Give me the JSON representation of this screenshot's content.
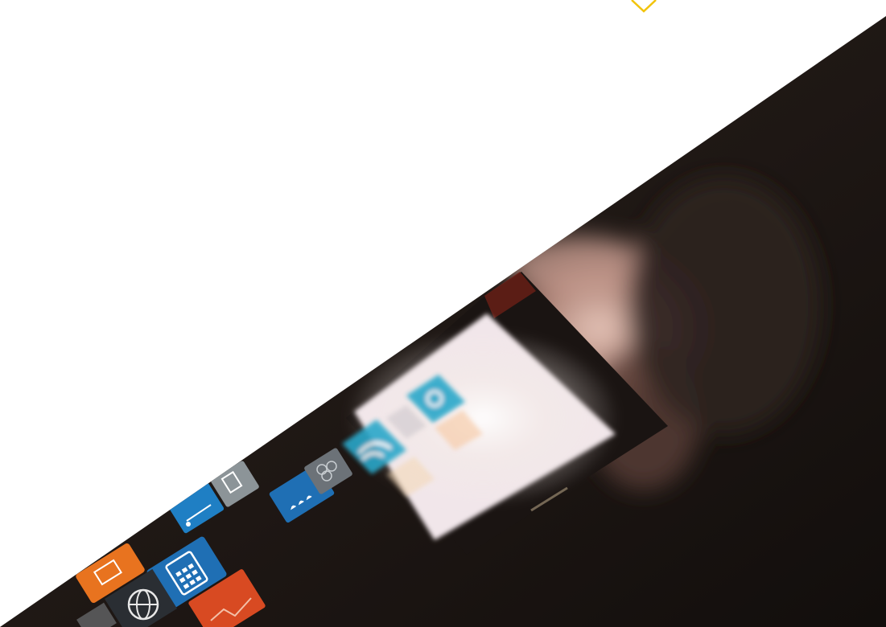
{
  "image": {
    "kind": "photo",
    "background_color": "#ffffff",
    "photo_base_color": "#1e1714",
    "accent_color": "#f2c40c"
  },
  "app_icons": [
    {
      "name": "presentation-icon",
      "color": "#e8731f"
    },
    {
      "name": "thermometer-icon",
      "color": "#1f7fc4"
    },
    {
      "name": "document-icon",
      "color": "#8c9498"
    },
    {
      "name": "calculator-icon",
      "color": "#1f6fb4"
    },
    {
      "name": "globe-icon",
      "color": "#2a2e33"
    },
    {
      "name": "chart-icon",
      "color": "#d84a22"
    },
    {
      "name": "weather-icon",
      "color": "#1f6fb4"
    },
    {
      "name": "grid-icon",
      "color": "#6c7278"
    },
    {
      "name": "wifi-icon",
      "color": "#2aa7c9"
    },
    {
      "name": "lightbulb-icon",
      "color": "#2aa7c9"
    }
  ]
}
